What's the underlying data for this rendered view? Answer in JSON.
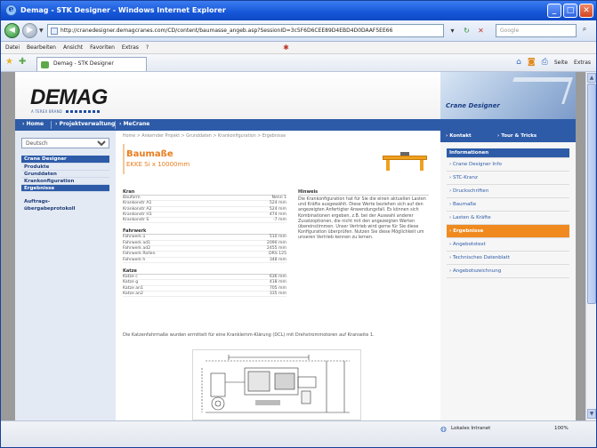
{
  "window": {
    "title": "Demag - STK Designer - Windows Internet Explorer",
    "buttons": {
      "minimize": "_",
      "maximize": "□",
      "close": "✕"
    }
  },
  "addressbar": {
    "back": "◀",
    "forward": "▶",
    "url": "http://cranedesigner.demagcranes.com/CD/content/baumasse_angeb.asp?SessionID=3c5F6D6CEE89D4EBD4D0DAAF5EE66",
    "search_placeholder": "Google"
  },
  "menu": {
    "items": [
      "Datei",
      "Bearbeiten",
      "Ansicht",
      "Favoriten",
      "Extras",
      "?"
    ]
  },
  "favorites": {
    "tab_label": "Demag - STK Designer"
  },
  "commandbar": {
    "page": "Seite",
    "extras": "Extras"
  },
  "site": {
    "logo": "DEMAG",
    "logo_sub": "A TEREX BRAND",
    "banner_title": "Crane Designer",
    "nav": [
      "Home",
      "Projektverwaltung",
      "MeCrane"
    ],
    "right_nav": [
      "Kontakt",
      "Tour & Tricks"
    ],
    "search_select": "Deutsch",
    "sidebar": {
      "items": [
        {
          "label": "Crane Designer",
          "type": "head"
        },
        {
          "label": "Produkte",
          "type": "item"
        },
        {
          "label": "Grunddaten",
          "type": "item"
        },
        {
          "label": "Krankonfiguration",
          "type": "item"
        },
        {
          "label": "Ergebnisse",
          "type": "active"
        }
      ],
      "extra": [
        "Auftrags-",
        "übergabeprotokoll"
      ]
    },
    "breadcrumb": "Home > Ankernder Projekt > Grunddaten > Krankonfiguration > Ergebnisse",
    "heading": "Baumaße",
    "subheading": "EKKE Si x 10000mm",
    "specs": [
      {
        "head": "Kran",
        "rows": [
          [
            "Bauform",
            "Nenn 1"
          ],
          [
            "Krankonstr A1",
            "524 mm"
          ],
          [
            "Krankonstr A2",
            "524 mm"
          ],
          [
            "Krankonstr H1",
            "474 mm"
          ],
          [
            "Krankonstr S",
            "-7 mm"
          ]
        ]
      },
      {
        "head": "Fahrwerk",
        "rows": [
          [
            "Fahrwerk ü",
            "510 mm"
          ],
          [
            "Fahrwerk ad1",
            "2090 mm"
          ],
          [
            "Fahrwerk ad2",
            "2455 mm"
          ],
          [
            "Fahrwerk Rollen",
            "DRS 125"
          ],
          [
            "Fahrwerk h",
            "348 mm"
          ]
        ]
      },
      {
        "head": "Katze",
        "rows": [
          [
            "Katze c",
            "636 mm"
          ],
          [
            "Katze g",
            "418 mm"
          ],
          [
            "Katze an1",
            "705 mm"
          ],
          [
            "Katze an2",
            "335 mm"
          ]
        ]
      }
    ],
    "notes_head": "Hinweis",
    "notes_body": "Die Krankonfiguration hat für Sie die einen aktuellen Lasten und Kräfte ausgewählt. Diese Werte beziehen sich auf den angezeigten Anfertigter Anwendungsfall. Es können sich Kombinationen ergeben, z.B. bei der Auswahl anderer Zusatzoptionen, die nicht mit den angezeigten Werten übereinstimmen. Unser Vertrieb wird gerne für Sie diese Konfiguration überprüfen. Nutzen Sie diese Möglichkeit um unseren Vertrieb kennen zu lernen.",
    "footnote": "Die Katzenfahrmaße wurden ermittelt für eine Kranklemm-Klärung (DCL) mit Drehstrommotoren auf Kranseite 1.",
    "right_menu": [
      {
        "label": "Informationen",
        "type": "head"
      },
      {
        "label": "Crane Designer Info",
        "type": "item"
      },
      {
        "label": "STC-Kranz",
        "type": "item"
      },
      {
        "label": "Druckschriften",
        "type": "item"
      },
      {
        "label": "Baumaße",
        "type": "item"
      },
      {
        "label": "Lasten & Kräfte",
        "type": "item"
      },
      {
        "label": "Ergebnisse",
        "type": "active"
      },
      {
        "label": "Angebotstext",
        "type": "item"
      },
      {
        "label": "Technisches Datenblatt",
        "type": "item"
      },
      {
        "label": "Angebotszeichnung",
        "type": "item"
      }
    ]
  },
  "status": {
    "zone": "Lokales Intranet",
    "zoom": "100%"
  }
}
